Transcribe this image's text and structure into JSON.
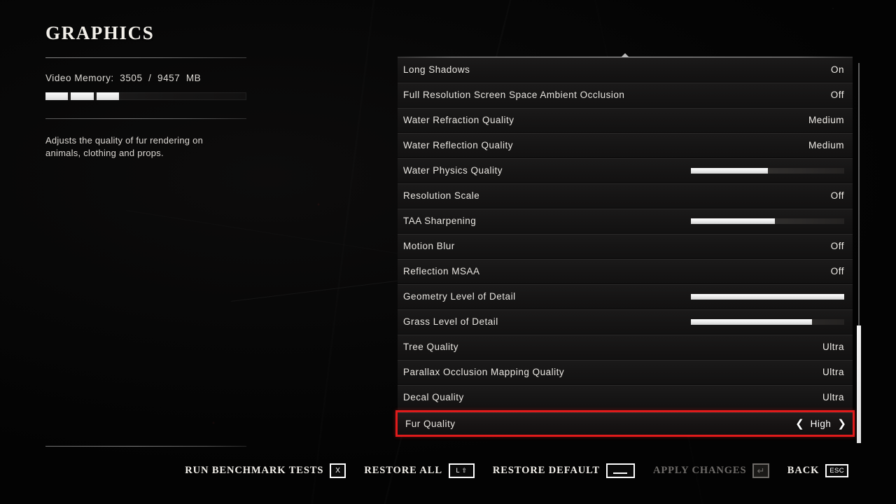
{
  "page": {
    "title": "GRAPHICS"
  },
  "info": {
    "vram_label": "Video Memory:  3505  /  9457  MB",
    "vram_used_mb": 3505,
    "vram_total_mb": 9457,
    "vram_segments_total": 8,
    "vram_segments_filled": 3,
    "description": "Adjusts the quality of fur rendering on animals, clothing and props."
  },
  "settings": {
    "rows": [
      {
        "label": "Long Shadows",
        "type": "value",
        "value": "On"
      },
      {
        "label": "Full Resolution Screen Space Ambient Occlusion",
        "type": "value",
        "value": "Off"
      },
      {
        "label": "Water Refraction Quality",
        "type": "value",
        "value": "Medium"
      },
      {
        "label": "Water Reflection Quality",
        "type": "value",
        "value": "Medium"
      },
      {
        "label": "Water Physics Quality",
        "type": "slider",
        "percent": 50
      },
      {
        "label": "Resolution Scale",
        "type": "value",
        "value": "Off"
      },
      {
        "label": "TAA Sharpening",
        "type": "slider",
        "percent": 55
      },
      {
        "label": "Motion Blur",
        "type": "value",
        "value": "Off"
      },
      {
        "label": "Reflection MSAA",
        "type": "value",
        "value": "Off"
      },
      {
        "label": "Geometry Level of Detail",
        "type": "slider",
        "percent": 100
      },
      {
        "label": "Grass Level of Detail",
        "type": "slider",
        "percent": 79
      },
      {
        "label": "Tree Quality",
        "type": "value",
        "value": "Ultra"
      },
      {
        "label": "Parallax Occlusion Mapping Quality",
        "type": "value",
        "value": "Ultra"
      },
      {
        "label": "Decal Quality",
        "type": "value",
        "value": "Ultra"
      },
      {
        "label": "Fur Quality",
        "type": "stepper",
        "value": "High",
        "selected": true,
        "left_arrow": "❮",
        "right_arrow": "❯"
      }
    ]
  },
  "actions": [
    {
      "label": "Run Benchmark Tests",
      "key": "X",
      "key_style": "letter",
      "disabled": false
    },
    {
      "label": "Restore All",
      "key": "L ⇧",
      "key_style": "shift",
      "disabled": false
    },
    {
      "label": "Restore Default",
      "key": "",
      "key_style": "space",
      "disabled": false
    },
    {
      "label": "Apply Changes",
      "key": "↵",
      "key_style": "enter",
      "disabled": true
    },
    {
      "label": "Back",
      "key": "ESC",
      "key_style": "esc",
      "disabled": false
    }
  ],
  "scrollbar": {
    "thumb_top_pct": 69,
    "thumb_height_pct": 31
  },
  "colors": {
    "accent_highlight": "#e01b1b",
    "text_primary": "#e9e6e1",
    "text_disabled": "#6f6c69",
    "row_bg": "#161515",
    "slider_fill": "#ffffff"
  }
}
